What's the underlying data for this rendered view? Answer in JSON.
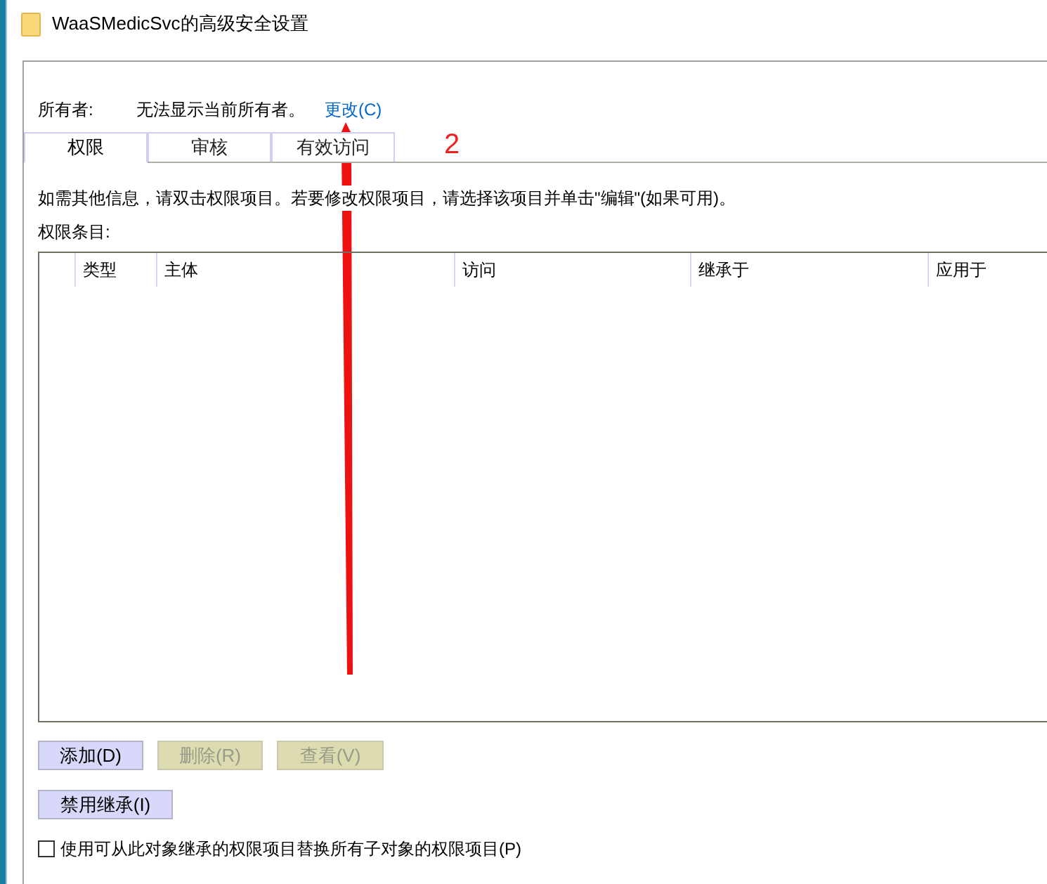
{
  "window": {
    "title": "WaaSMedicSvc的高级安全设置"
  },
  "owner": {
    "label": "所有者:",
    "value": "无法显示当前所有者。",
    "link": "更改(C)"
  },
  "tabs": [
    {
      "label": "权限",
      "selected": true
    },
    {
      "label": "审核",
      "selected": false
    },
    {
      "label": "有效访问",
      "selected": false
    }
  ],
  "info": "如需其他信息，请双击权限项目。若要修改权限项目，请选择该项目并单击\"编辑\"(如果可用)。",
  "entries_label": "权限条目:",
  "table": {
    "columns": [
      "类型",
      "主体",
      "访问",
      "继承于",
      "应用于"
    ]
  },
  "buttons": [
    {
      "label": "添加(D)",
      "disabled": false
    },
    {
      "label": "删除(R)",
      "disabled": true
    },
    {
      "label": "查看(V)",
      "disabled": true
    }
  ],
  "inherit_button": {
    "label": "禁用继承(I)",
    "disabled": false
  },
  "replace_checkbox": {
    "label": "使用可从此对象继承的权限项目替换所有子对象的权限项目(P)",
    "checked": false
  },
  "annotation": {
    "label": "2"
  }
}
